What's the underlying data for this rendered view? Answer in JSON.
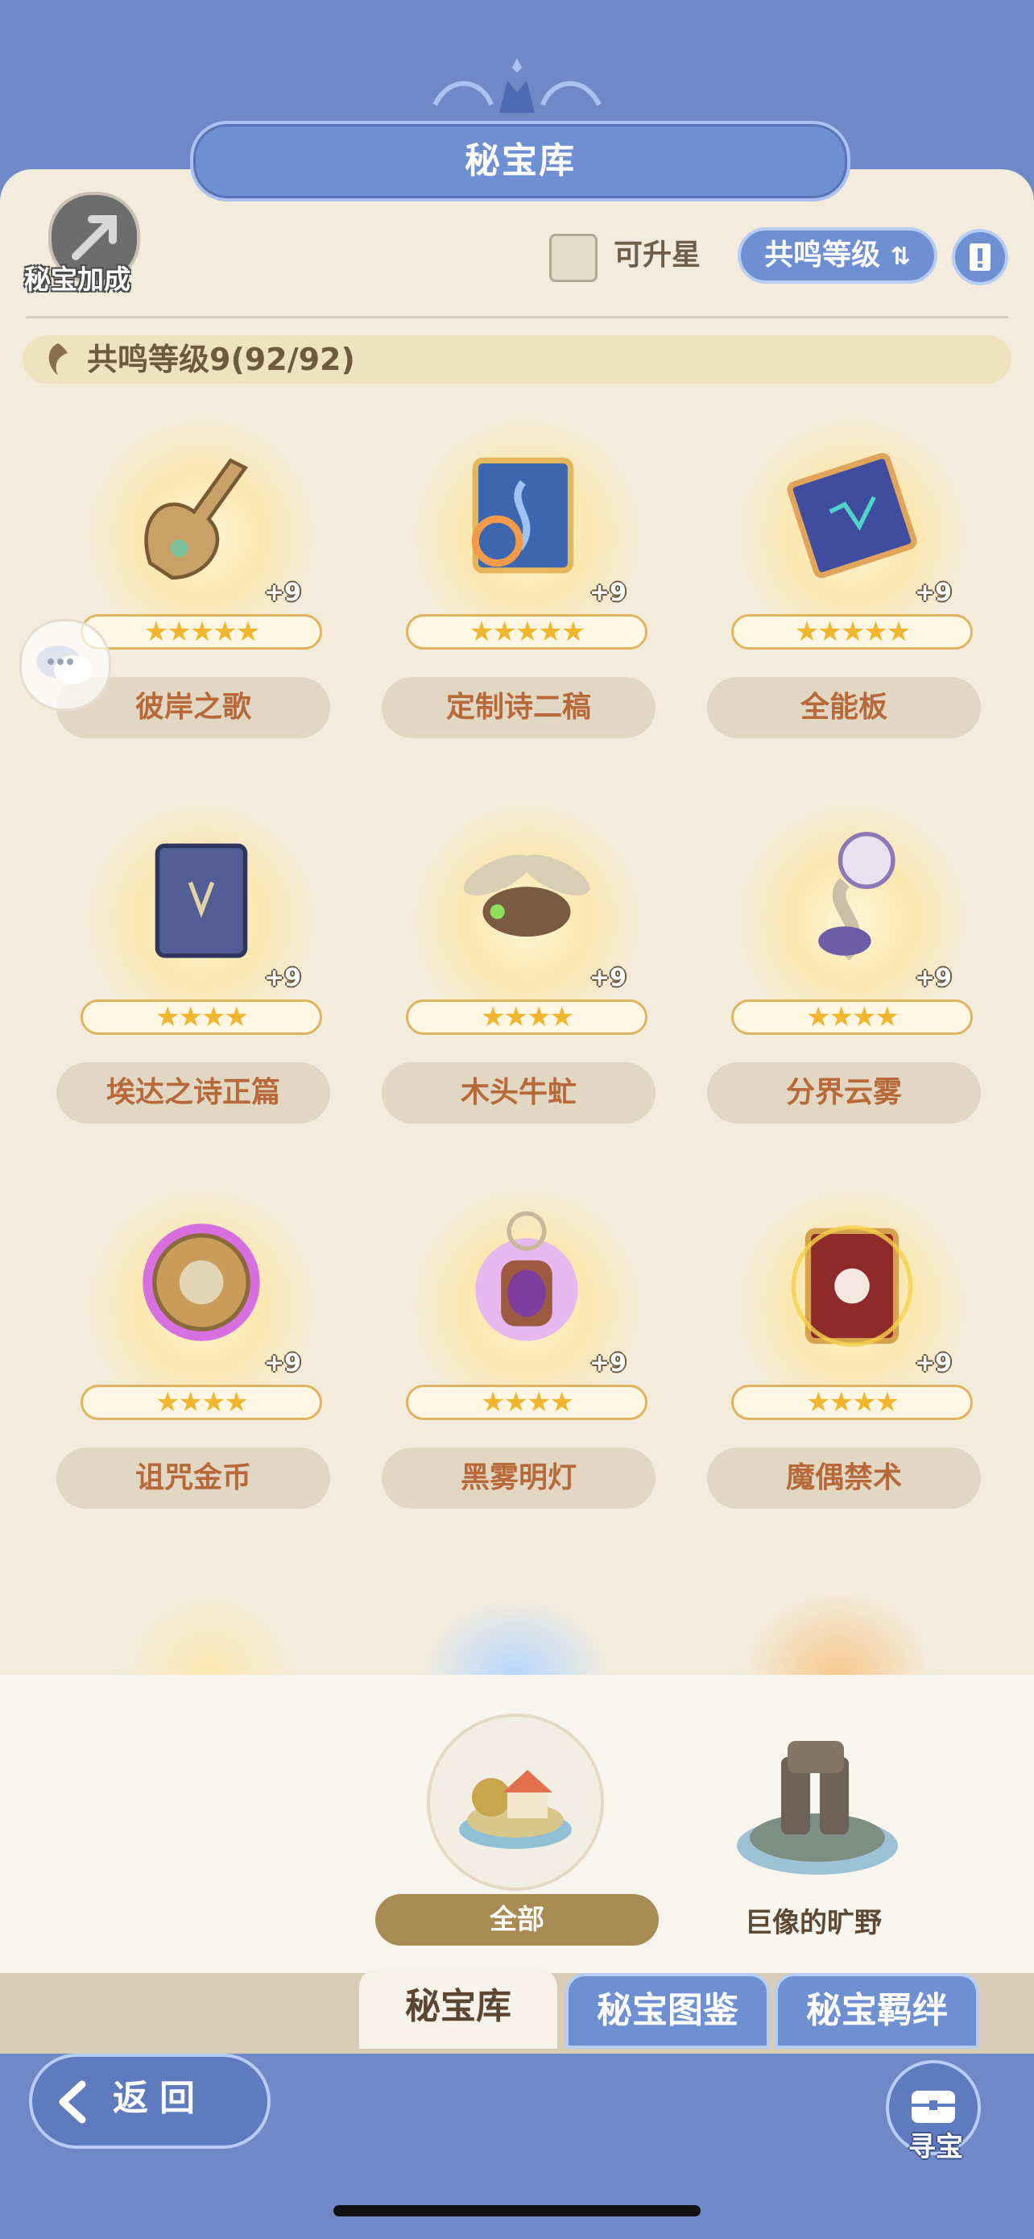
{
  "header": {
    "title": "秘宝库"
  },
  "toolbar": {
    "bonus_label": "秘宝加成",
    "upgradable_label": "可升星",
    "sort_label": "共鸣等级"
  },
  "resonance": {
    "text": "共鸣等级9(92/92)"
  },
  "relics": [
    {
      "name": "彼岸之歌",
      "plus": "+9",
      "stars": "★★★★★"
    },
    {
      "name": "定制诗二稿",
      "plus": "+9",
      "stars": "★★★★★"
    },
    {
      "name": "全能板",
      "plus": "+9",
      "stars": "★★★★★"
    },
    {
      "name": "埃达之诗正篇",
      "plus": "+9",
      "stars": "★★★★"
    },
    {
      "name": "木头牛虻",
      "plus": "+9",
      "stars": "★★★★"
    },
    {
      "name": "分界云雾",
      "plus": "+9",
      "stars": "★★★★"
    },
    {
      "name": "诅咒金币",
      "plus": "+9",
      "stars": "★★★★"
    },
    {
      "name": "黑雾明灯",
      "plus": "+9",
      "stars": "★★★★"
    },
    {
      "name": "魔偶禁术",
      "plus": "+9",
      "stars": "★★★★"
    }
  ],
  "regions": {
    "all_label": "全部",
    "colossus_label": "巨像的旷野"
  },
  "tabs": {
    "vault": "秘宝库",
    "codex": "秘宝图鉴",
    "bond": "秘宝羁绊"
  },
  "footer": {
    "back_label": "返回",
    "treasure_label": "寻宝"
  },
  "colors": {
    "accent_blue": "#6f8fd3",
    "parchment": "#f3ecdc",
    "name_text": "#b8693a",
    "star": "#f2b52e"
  }
}
